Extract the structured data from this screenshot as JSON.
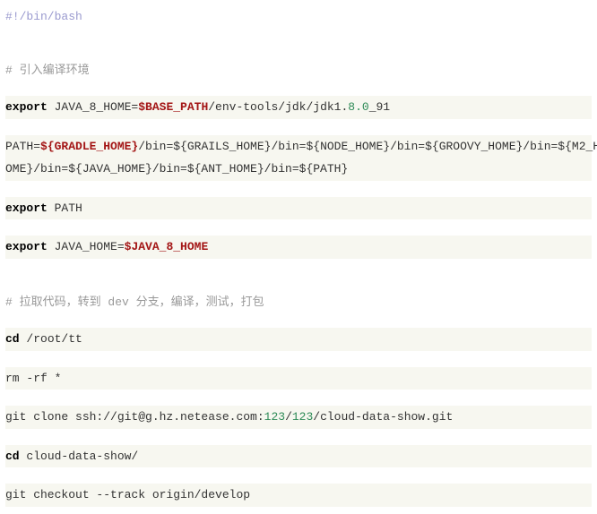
{
  "code": {
    "shebang": "#!/bin/bash",
    "comment1_prefix": "# ",
    "comment1_text": "引入编译环境",
    "export_kw": "export",
    "java8_assign": " JAVA_8_HOME=",
    "base_path_var": "$BASE_PATH",
    "java8_suffix1": "/env-tools/jdk/jdk1.",
    "java8_ver": "8.0",
    "java8_suffix2": "_91",
    "path_prefix": "PATH=",
    "gradle_home": "${GRADLE_HOME}",
    "path_mid1": "/bin=${GRAILS_HOME}/bin=${NODE_HOME}/bin=${GROOVY_HOME}/bin=${M2_H",
    "path_line2": "OME}/bin=${JAVA_HOME}/bin=${ANT_HOME}/bin=${PATH}",
    "export_path": " PATH",
    "export_javahome": " JAVA_HOME=",
    "java8_home_var": "$JAVA_8_HOME",
    "comment2_prefix": "# ",
    "comment2_a": "拉取代码，转到 ",
    "comment2_dev": "dev ",
    "comment2_b": "分支，编译，测试，打包",
    "cd_kw": "cd",
    "cd_root": " /root/tt",
    "rm_line": "rm -rf *",
    "git_clone_a": "git clone ssh://git@g.hz.netease.com:",
    "num123a": "123",
    "slash": "/",
    "num123b": "123",
    "git_clone_b": "/cloud-data-show.git",
    "cd_show": " cloud-data-show/",
    "git_checkout": "git checkout --track origin/develop"
  }
}
